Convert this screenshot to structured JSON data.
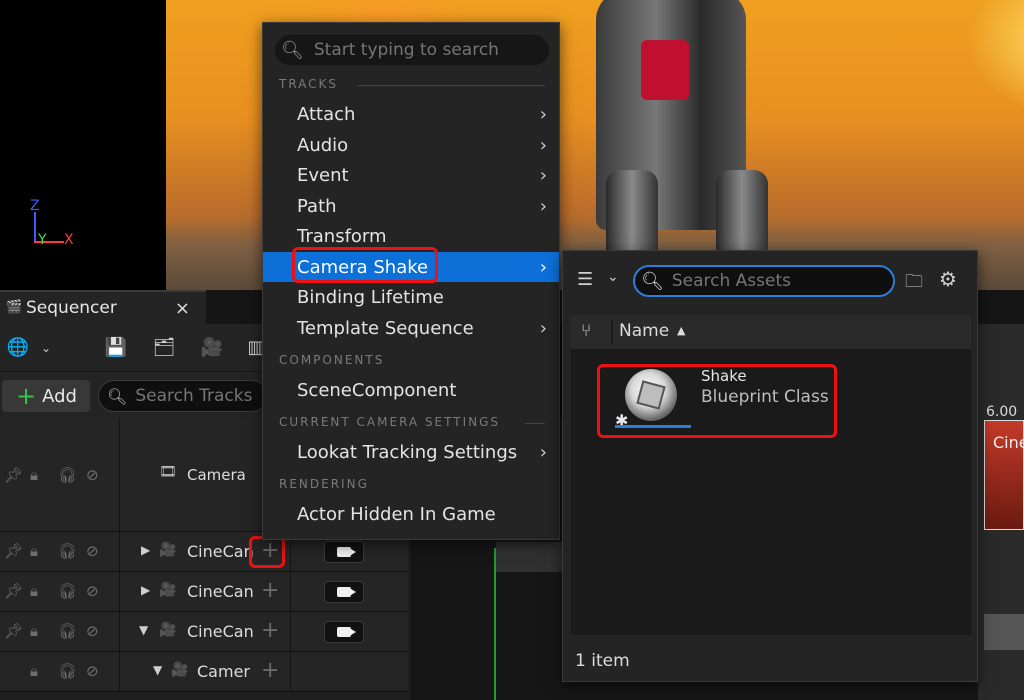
{
  "viewport": {
    "gizmo": {
      "z": "Z",
      "y": "Y",
      "x": "X"
    }
  },
  "sequencer": {
    "tab_title": "Sequencer",
    "close_glyph": "×",
    "add_label": "Add",
    "search_placeholder": "Search Tracks",
    "camera_label": "Camera",
    "tracks": [
      {
        "label": "CineCan"
      },
      {
        "label": "CineCan"
      },
      {
        "label": "CineCan"
      },
      {
        "label": "Camer"
      }
    ],
    "time_label": "6.00",
    "clip_label": "Cine"
  },
  "context_menu": {
    "search_placeholder": "Start typing to search",
    "sections": {
      "tracks": "TRACKS",
      "components": "COMPONENTS",
      "camera_settings": "CURRENT CAMERA SETTINGS",
      "rendering": "RENDERING"
    },
    "items": [
      {
        "label": "Attach",
        "submenu": true
      },
      {
        "label": "Audio",
        "submenu": true
      },
      {
        "label": "Event",
        "submenu": true
      },
      {
        "label": "Path",
        "submenu": true
      },
      {
        "label": "Transform",
        "submenu": false
      },
      {
        "label": "Camera Shake",
        "submenu": true,
        "active": true
      },
      {
        "label": "Binding Lifetime",
        "submenu": false
      },
      {
        "label": "Template Sequence",
        "submenu": true
      },
      {
        "label": "SceneComponent",
        "submenu": false
      },
      {
        "label": "Lookat Tracking Settings",
        "submenu": true
      },
      {
        "label": "Actor Hidden In Game",
        "submenu": false
      }
    ],
    "chevron": "›"
  },
  "asset_picker": {
    "search_placeholder": "Search Assets",
    "column_name": "Name",
    "sort_glyph": "▲",
    "asset": {
      "name": "Shake",
      "type": "Blueprint Class"
    },
    "item_count": "1 item"
  },
  "colors": {
    "highlight": "#0d6fd8",
    "annotation_red": "#ee1111",
    "add_plus": "#36c24a"
  }
}
